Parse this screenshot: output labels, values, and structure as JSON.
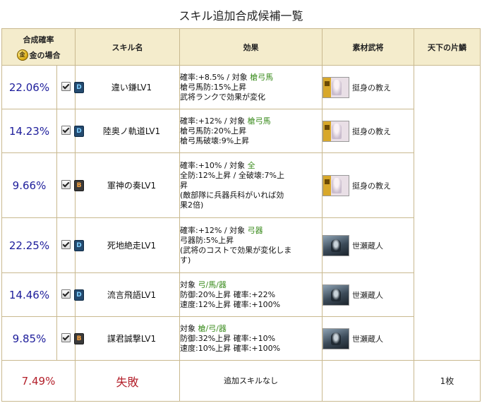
{
  "title": "スキル追加合成候補一覧",
  "headers": {
    "rate": "合成確率",
    "gold_icon": "金",
    "gold_case": "金の場合",
    "skill": "スキル名",
    "effect": "効果",
    "material": "素材武将",
    "tenka": "天下の片鱗"
  },
  "rows": [
    {
      "rate": "22.06%",
      "rank": "D",
      "skill": "違い鎌LV1",
      "effect": [
        [
          "確率:+8.5% / 対象 ",
          "槍弓馬"
        ],
        [
          "槍弓馬防:15%上昇",
          ""
        ],
        [
          "武将ランクで効果が変化",
          ""
        ]
      ],
      "material": "挺身の教え"
    },
    {
      "rate": "14.23%",
      "rank": "D",
      "skill": "陸奥ノ軌道LV1",
      "effect": [
        [
          "確率:+12% / 対象 ",
          "槍弓馬"
        ],
        [
          "槍弓馬防:20%上昇",
          ""
        ],
        [
          "槍弓馬破壊:9%上昇",
          ""
        ]
      ],
      "material": "挺身の教え"
    },
    {
      "rate": "9.66%",
      "rank": "B",
      "skill": "軍神の奏LV1",
      "effect": [
        [
          "確率:+10% / 対象 ",
          "全"
        ],
        [
          "全防:12%上昇 / 全破壊:7%上",
          ""
        ],
        [
          "昇",
          ""
        ],
        [
          "(敵部隊に兵器兵科がいれば効",
          ""
        ],
        [
          "果2倍)",
          ""
        ]
      ],
      "material": "挺身の教え"
    },
    {
      "rate": "22.25%",
      "rank": "D",
      "skill": "死地絶走LV1",
      "effect": [
        [
          "確率:+12% / 対象 ",
          "弓器"
        ],
        [
          "弓器防:5%上昇",
          ""
        ],
        [
          "(武将のコストで効果が変化しま",
          ""
        ],
        [
          "す)",
          ""
        ]
      ],
      "material": "世瀬蔵人"
    },
    {
      "rate": "14.46%",
      "rank": "D",
      "skill": "流言飛語LV1",
      "effect": [
        [
          "対象 ",
          "弓/馬/器"
        ],
        [
          "防御:20%上昇 確率:+22%",
          ""
        ],
        [
          "速度:12%上昇 確率:+100%",
          ""
        ]
      ],
      "material": "世瀬蔵人"
    },
    {
      "rate": "9.85%",
      "rank": "B",
      "skill": "謀君誠撃LV1",
      "effect": [
        [
          "対象 ",
          "槍/弓/器"
        ],
        [
          "防御:32%上昇 確率:+10%",
          ""
        ],
        [
          "速度:10%上昇 確率:+100%",
          ""
        ]
      ],
      "material": "世瀬蔵人"
    }
  ],
  "fail_row": {
    "rate": "7.49%",
    "label": "失敗",
    "effect": "追加スキルなし",
    "tenka": "1枚"
  },
  "colors": {
    "rate_blue": "#1d1d9b",
    "fail_red": "#b3202b",
    "target_green": "#3b8c1e",
    "header_bg": "#f4eccc",
    "border": "#c9b98f"
  },
  "icons": {
    "rank_badge": "rank-badge-icon",
    "checkbox": "checkbox-icon",
    "gold": "gold-coin-icon"
  }
}
